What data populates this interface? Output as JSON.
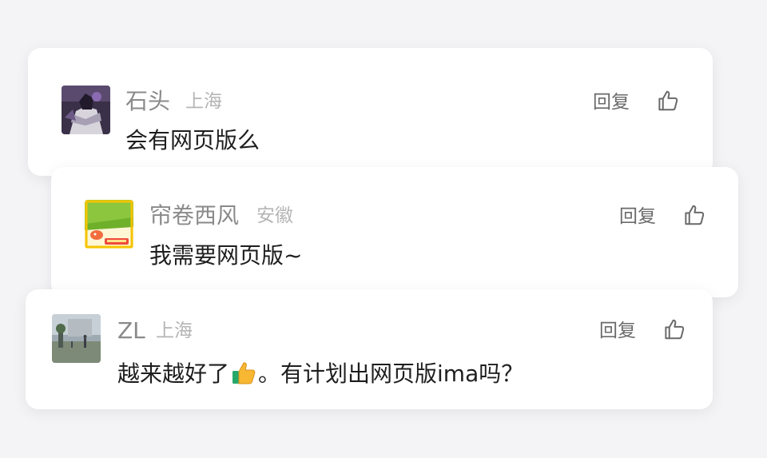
{
  "comments": [
    {
      "username": "石头",
      "location": "上海",
      "text": "会有网页版么",
      "reply_label": "回复",
      "avatar_icon": "anime-character-avatar",
      "like_icon": "thumbs-up-icon"
    },
    {
      "username": "帘卷西风",
      "location": "安徽",
      "text": "我需要网页版~",
      "reply_label": "回复",
      "avatar_icon": "green-fish-avatar",
      "like_icon": "thumbs-up-icon"
    },
    {
      "username": "ZL",
      "location": "上海",
      "text_before_emoji": "越来越好了",
      "emoji_icon": "thumbs-up-emoji",
      "text_after_emoji": "。有计划出网页版ima吗？",
      "reply_label": "回复",
      "avatar_icon": "outdoor-photo-avatar",
      "like_icon": "thumbs-up-icon"
    }
  ],
  "colors": {
    "background": "#f4f4f6",
    "card": "#ffffff",
    "username": "#8a8a8a",
    "location": "#b5b5b5",
    "comment_text": "#1e1e1e",
    "action": "#6a6a6a"
  }
}
